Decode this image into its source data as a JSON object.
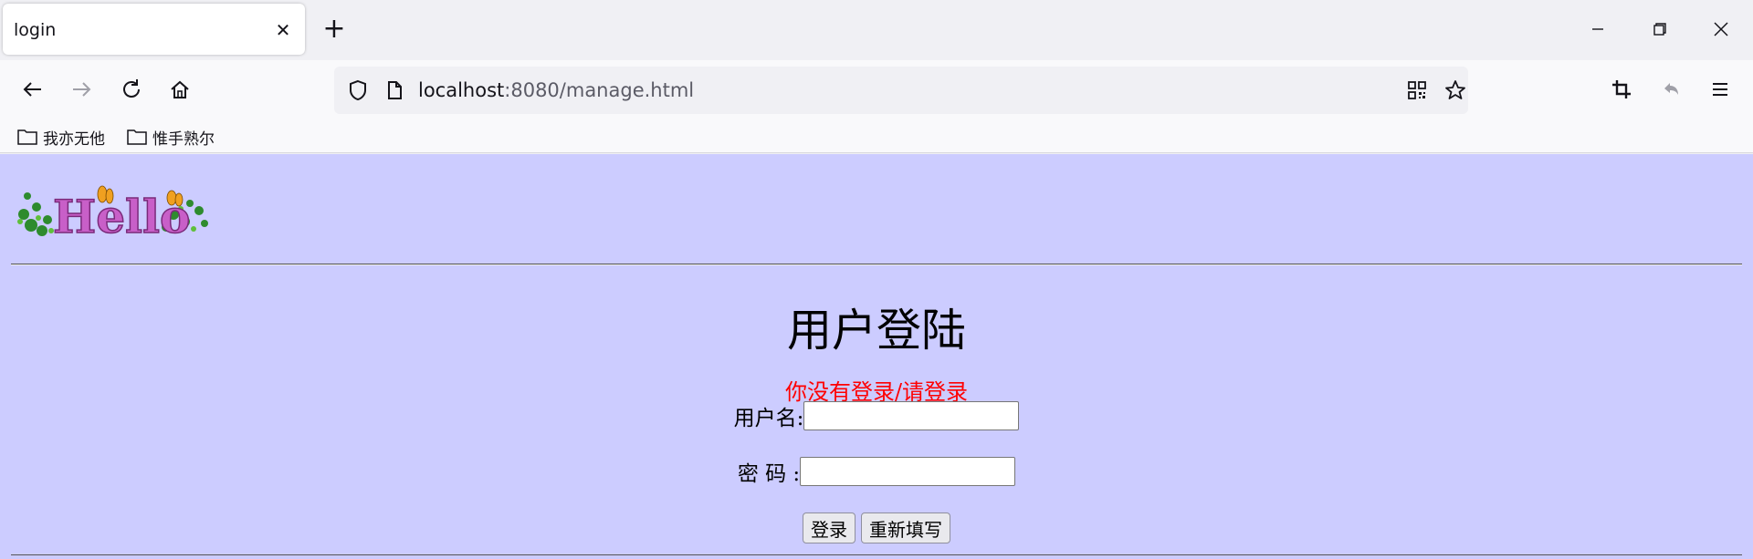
{
  "browser": {
    "tab_title": "login",
    "tab_close_glyph": "✕",
    "new_tab_glyph": "+",
    "url_host": "localhost",
    "url_rest": ":8080/manage.html",
    "icons": [
      "back-icon",
      "forward-icon",
      "reload-icon",
      "home-icon",
      "shield-icon",
      "page-icon",
      "qr-code-icon",
      "star-icon",
      "crop-icon",
      "undo-icon",
      "menu-icon",
      "minimize-icon",
      "restore-icon",
      "close-icon"
    ],
    "bookmarks": [
      {
        "label": "我亦无他"
      },
      {
        "label": "惟手熟尔"
      }
    ]
  },
  "page": {
    "logo_text": "Hello",
    "title": "用户登陆",
    "error_message": "你没有登录/请登录",
    "username_label": "用户名:",
    "username_value": "",
    "password_label": "密 码 :",
    "password_value": "",
    "login_button": "登录",
    "reset_button": "重新填写",
    "background_color": "#ccccff",
    "error_color": "#ff0000"
  }
}
